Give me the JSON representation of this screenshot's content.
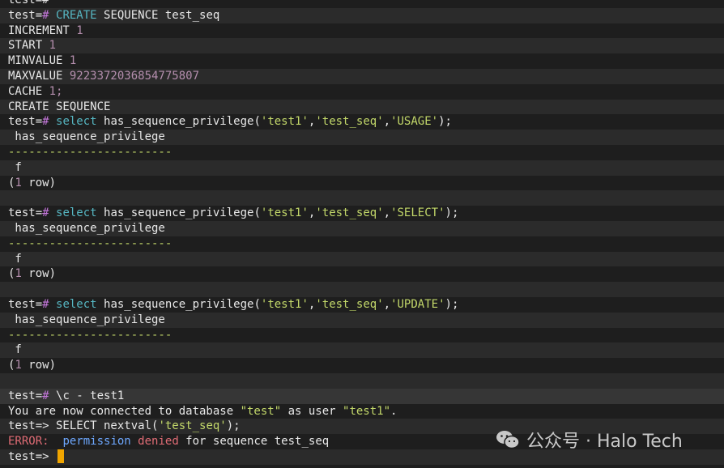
{
  "lines": [
    {
      "style": "even",
      "segments": [
        {
          "t": "test=#",
          "c": "prompt"
        }
      ]
    },
    {
      "style": "odd",
      "segments": [
        {
          "t": "test=",
          "c": "prompt"
        },
        {
          "t": "# ",
          "c": "hash"
        },
        {
          "t": "CREATE",
          "c": "kw"
        },
        {
          "t": " SEQUENCE test_seq",
          "c": "plain"
        }
      ]
    },
    {
      "style": "even",
      "segments": [
        {
          "t": "INCREMENT ",
          "c": "plain"
        },
        {
          "t": "1",
          "c": "num"
        }
      ]
    },
    {
      "style": "odd",
      "segments": [
        {
          "t": "START ",
          "c": "plain"
        },
        {
          "t": "1",
          "c": "num"
        }
      ]
    },
    {
      "style": "even",
      "segments": [
        {
          "t": "MINVALUE ",
          "c": "plain"
        },
        {
          "t": "1",
          "c": "num"
        }
      ]
    },
    {
      "style": "odd",
      "segments": [
        {
          "t": "MAXVALUE ",
          "c": "plain"
        },
        {
          "t": "9223372036854775807",
          "c": "num"
        }
      ]
    },
    {
      "style": "even",
      "segments": [
        {
          "t": "CACHE ",
          "c": "plain"
        },
        {
          "t": "1;",
          "c": "num"
        }
      ]
    },
    {
      "style": "odd",
      "segments": [
        {
          "t": "CREATE SEQUENCE",
          "c": "plain"
        }
      ]
    },
    {
      "style": "even",
      "segments": [
        {
          "t": "test=",
          "c": "prompt"
        },
        {
          "t": "# ",
          "c": "hash"
        },
        {
          "t": "select",
          "c": "kw"
        },
        {
          "t": " has_sequence_privilege(",
          "c": "plain"
        },
        {
          "t": "'test1'",
          "c": "str"
        },
        {
          "t": ",",
          "c": "plain"
        },
        {
          "t": "'test_seq'",
          "c": "str"
        },
        {
          "t": ",",
          "c": "plain"
        },
        {
          "t": "'USAGE'",
          "c": "str"
        },
        {
          "t": ");",
          "c": "plain"
        }
      ]
    },
    {
      "style": "odd",
      "segments": [
        {
          "t": " has_sequence_privilege",
          "c": "plain"
        }
      ]
    },
    {
      "style": "even",
      "segments": [
        {
          "t": "------------------------",
          "c": "dash"
        }
      ]
    },
    {
      "style": "odd",
      "segments": [
        {
          "t": " f",
          "c": "plain"
        }
      ]
    },
    {
      "style": "even",
      "segments": [
        {
          "t": "(",
          "c": "plain"
        },
        {
          "t": "1",
          "c": "num"
        },
        {
          "t": " row)",
          "c": "plain"
        }
      ]
    },
    {
      "style": "odd",
      "segments": []
    },
    {
      "style": "even",
      "segments": [
        {
          "t": "test=",
          "c": "prompt"
        },
        {
          "t": "# ",
          "c": "hash"
        },
        {
          "t": "select",
          "c": "kw"
        },
        {
          "t": " has_sequence_privilege(",
          "c": "plain"
        },
        {
          "t": "'test1'",
          "c": "str"
        },
        {
          "t": ",",
          "c": "plain"
        },
        {
          "t": "'test_seq'",
          "c": "str"
        },
        {
          "t": ",",
          "c": "plain"
        },
        {
          "t": "'SELECT'",
          "c": "str"
        },
        {
          "t": ");",
          "c": "plain"
        }
      ]
    },
    {
      "style": "odd",
      "segments": [
        {
          "t": " has_sequence_privilege",
          "c": "plain"
        }
      ]
    },
    {
      "style": "even",
      "segments": [
        {
          "t": "------------------------",
          "c": "dash"
        }
      ]
    },
    {
      "style": "odd",
      "segments": [
        {
          "t": " f",
          "c": "plain"
        }
      ]
    },
    {
      "style": "even",
      "segments": [
        {
          "t": "(",
          "c": "plain"
        },
        {
          "t": "1",
          "c": "num"
        },
        {
          "t": " row)",
          "c": "plain"
        }
      ]
    },
    {
      "style": "odd",
      "segments": []
    },
    {
      "style": "even",
      "segments": [
        {
          "t": "test=",
          "c": "prompt"
        },
        {
          "t": "# ",
          "c": "hash"
        },
        {
          "t": "select",
          "c": "kw"
        },
        {
          "t": " has_sequence_privilege(",
          "c": "plain"
        },
        {
          "t": "'test1'",
          "c": "str"
        },
        {
          "t": ",",
          "c": "plain"
        },
        {
          "t": "'test_seq'",
          "c": "str"
        },
        {
          "t": ",",
          "c": "plain"
        },
        {
          "t": "'UPDATE'",
          "c": "str"
        },
        {
          "t": ");",
          "c": "plain"
        }
      ]
    },
    {
      "style": "odd",
      "segments": [
        {
          "t": " has_sequence_privilege",
          "c": "plain"
        }
      ]
    },
    {
      "style": "even",
      "segments": [
        {
          "t": "------------------------",
          "c": "dash"
        }
      ]
    },
    {
      "style": "odd",
      "segments": [
        {
          "t": " f",
          "c": "plain"
        }
      ]
    },
    {
      "style": "even",
      "segments": [
        {
          "t": "(",
          "c": "plain"
        },
        {
          "t": "1",
          "c": "num"
        },
        {
          "t": " row)",
          "c": "plain"
        }
      ]
    },
    {
      "style": "odd",
      "segments": []
    },
    {
      "style": "hl",
      "segments": [
        {
          "t": "test=",
          "c": "prompt"
        },
        {
          "t": "# ",
          "c": "hash"
        },
        {
          "t": "\\c - test1",
          "c": "plain"
        }
      ]
    },
    {
      "style": "even",
      "segments": [
        {
          "t": "You are now connected to database ",
          "c": "plain"
        },
        {
          "t": "\"test\"",
          "c": "str"
        },
        {
          "t": " as user ",
          "c": "plain"
        },
        {
          "t": "\"test1\"",
          "c": "str"
        },
        {
          "t": ".",
          "c": "plain"
        }
      ]
    },
    {
      "style": "odd",
      "segments": [
        {
          "t": "test=> SELECT nextval(",
          "c": "plain"
        },
        {
          "t": "'test_seq'",
          "c": "str"
        },
        {
          "t": ");",
          "c": "plain"
        }
      ]
    },
    {
      "style": "even",
      "segments": [
        {
          "t": "ERROR:",
          "c": "err"
        },
        {
          "t": "  ",
          "c": "plain"
        },
        {
          "t": "permission",
          "c": "err-kw"
        },
        {
          "t": " ",
          "c": "plain"
        },
        {
          "t": "denied",
          "c": "err"
        },
        {
          "t": " for sequence test_seq",
          "c": "plain"
        }
      ]
    },
    {
      "style": "odd",
      "segments": [
        {
          "t": "test=> ",
          "c": "plain"
        }
      ],
      "cursor": true
    }
  ],
  "watermark": {
    "icon": "wechat-icon",
    "text": "公众号 · Halo Tech"
  },
  "colors": {
    "background": "#1e1e1e",
    "keyword": "#56b6c2",
    "number": "#b48ead",
    "string": "#c3d86a",
    "error": "#e06c75",
    "cursor": "#f0a500"
  }
}
